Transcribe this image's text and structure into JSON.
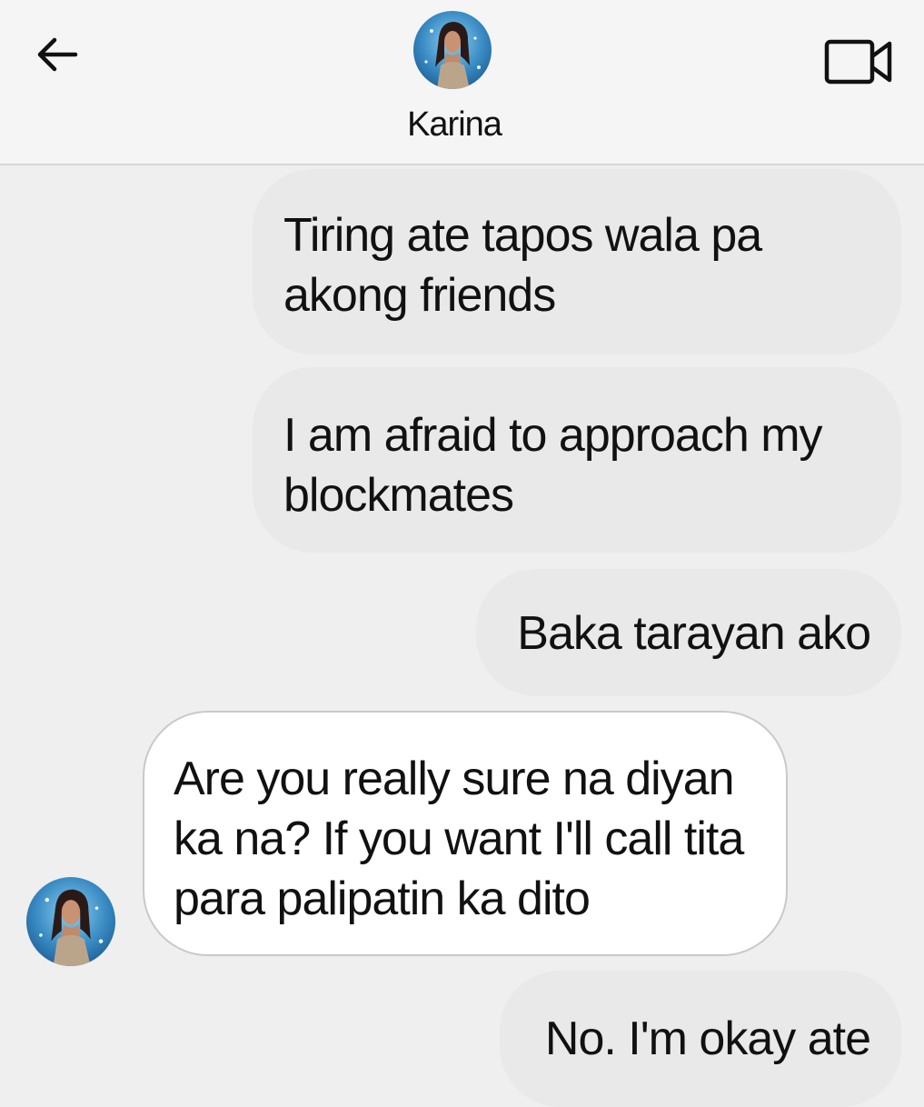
{
  "header": {
    "contact_name": "Karina",
    "back_icon": "arrow-left-icon",
    "video_icon": "video-camera-icon"
  },
  "messages": [
    {
      "direction": "outgoing",
      "text": "Tiring ate tapos wala pa akong friends"
    },
    {
      "direction": "outgoing",
      "text": "I am afraid to approach my blockmates"
    },
    {
      "direction": "outgoing",
      "text": "Baka tarayan ako"
    },
    {
      "direction": "incoming",
      "text": "Are you really sure na diyan ka na? If you want I'll call tita para palipatin ka dito"
    },
    {
      "direction": "outgoing",
      "text": "No. I'm okay ate"
    }
  ],
  "colors": {
    "background": "#efefef",
    "header_background": "#f5f5f5",
    "outgoing_bubble": "#e9e9e9",
    "incoming_bubble": "#ffffff",
    "avatar_background": "#3a8cc4"
  }
}
